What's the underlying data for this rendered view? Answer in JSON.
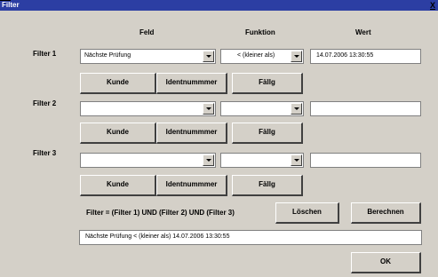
{
  "window": {
    "title": "Filter",
    "close_label": "X"
  },
  "headers": {
    "feld": "Feld",
    "funktion": "Funktion",
    "wert": "Wert"
  },
  "filters": [
    {
      "label": "Filter 1",
      "feld": "Nächste Prüfung",
      "funktion": "< (kleiner als)",
      "wert": "14.07.2006 13:30:55",
      "buttons": {
        "kunde": "Kunde",
        "identnummer": "Identnummmer",
        "faellig": "Fällg"
      }
    },
    {
      "label": "Filter 2",
      "feld": "",
      "funktion": "",
      "wert": "",
      "buttons": {
        "kunde": "Kunde",
        "identnummer": "Identnummmer",
        "faellig": "Fällg"
      }
    },
    {
      "label": "Filter 3",
      "feld": "",
      "funktion": "",
      "wert": "",
      "buttons": {
        "kunde": "Kunde",
        "identnummer": "Identnummmer",
        "faellig": "Fällg"
      }
    }
  ],
  "formula": "Filter = (Filter 1) UND (Filter 2) UND (Filter 3)",
  "loeschen_label": "Löschen",
  "berechnen_label": "Berechnen",
  "result": "Nächste Prüfung < (kleiner als) 14.07.2006 13:30:55",
  "ok_label": "OK"
}
